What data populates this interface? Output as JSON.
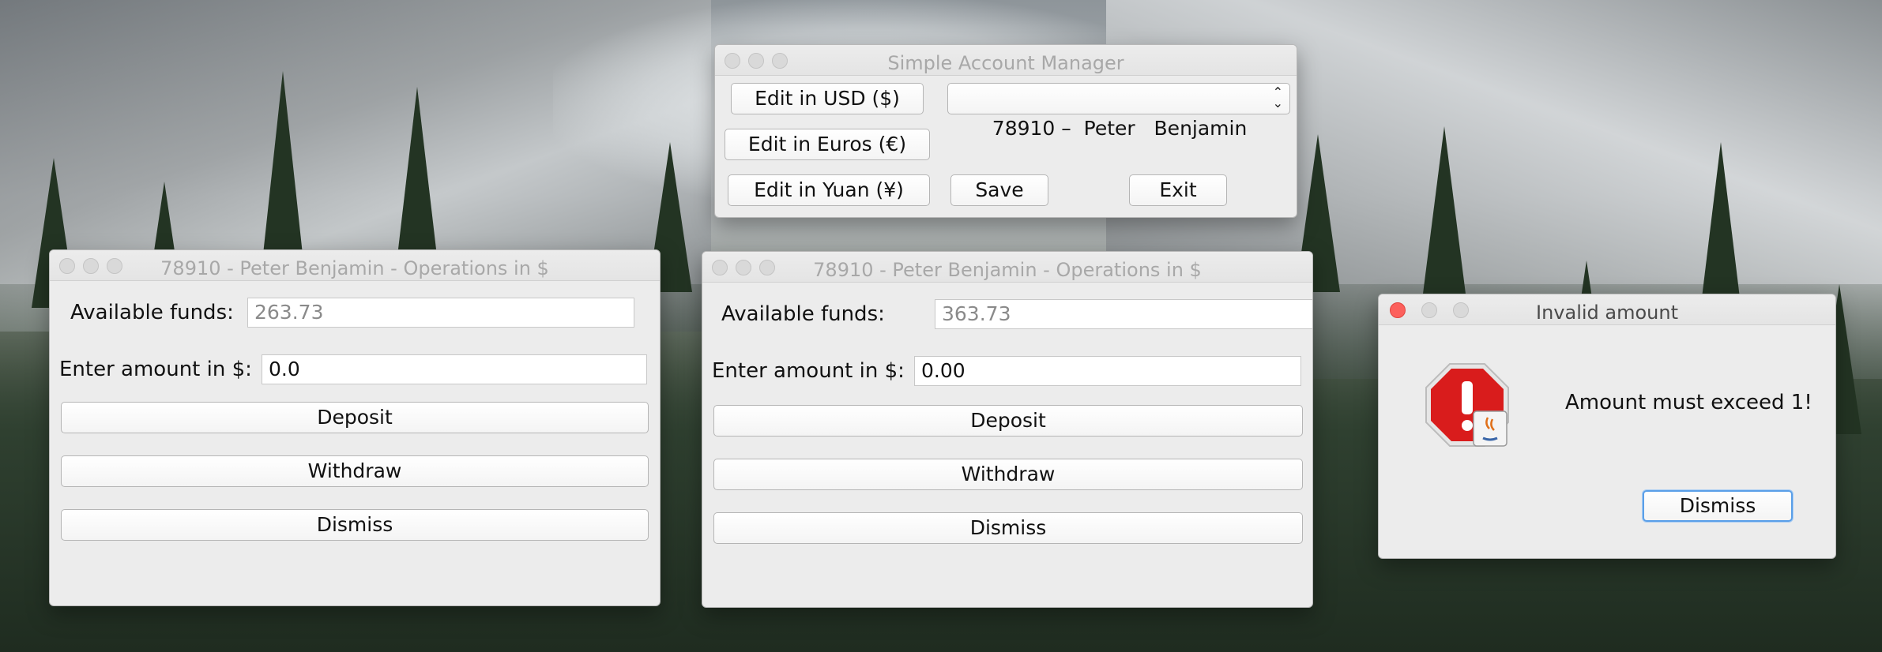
{
  "desktop": {
    "wallpaper": "mountain-forest-wallpaper"
  },
  "account_manager": {
    "title": "Simple Account Manager",
    "edit_usd": "Edit in USD ($)",
    "edit_euros": "Edit in Euros (€)",
    "edit_yuan": "Edit in Yuan (¥)",
    "save": "Save",
    "exit": "Exit",
    "account_select": "78910 –  Peter   Benjamin"
  },
  "ops_window_1": {
    "title": "78910 -  Peter   Benjamin - Operations in $",
    "available_label": "Available funds:",
    "available_value": "263.73",
    "amount_label": "Enter amount in $:",
    "amount_value": "0.0",
    "deposit": "Deposit",
    "withdraw": "Withdraw",
    "dismiss": "Dismiss"
  },
  "ops_window_2": {
    "title": "78910 -  Peter   Benjamin - Operations in $",
    "available_label": "Available funds:",
    "available_value": "363.73",
    "amount_label": "Enter amount in $:",
    "amount_value": "0.00",
    "deposit": "Deposit",
    "withdraw": "Withdraw",
    "dismiss": "Dismiss"
  },
  "alert": {
    "title": "Invalid amount",
    "message": "Amount must exceed 1!",
    "dismiss": "Dismiss",
    "icon": "error-stop-icon"
  },
  "colors": {
    "window_bg": "#ececec",
    "close_red": "#fc605c",
    "focus_blue": "#5a9fe8",
    "stop_red": "#d91c1c"
  }
}
